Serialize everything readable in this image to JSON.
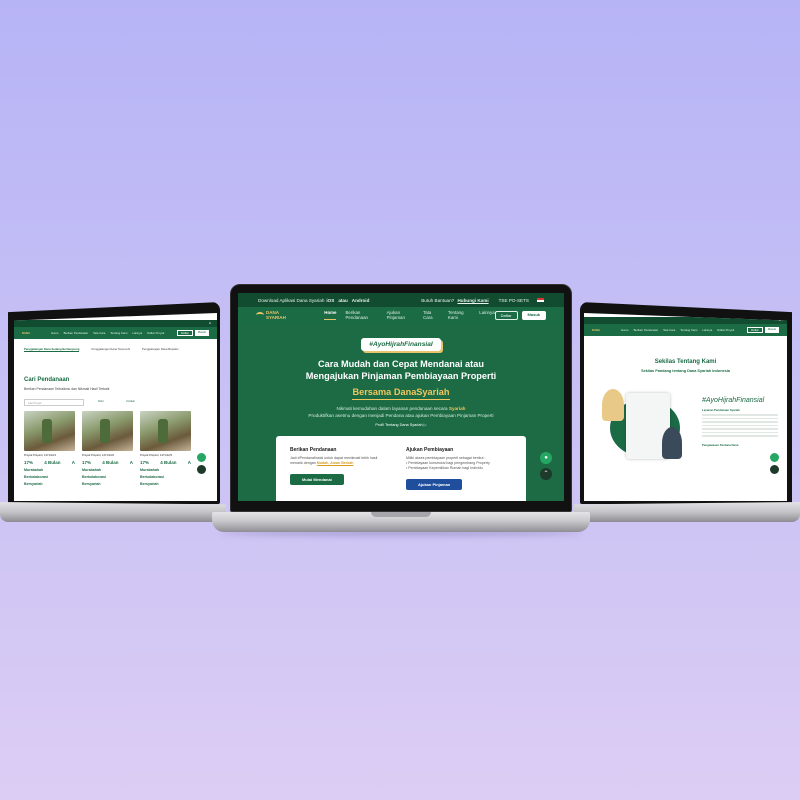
{
  "center": {
    "topbar": {
      "download_prefix": "Download Aplikasi Dana Syariah",
      "ios": "iOS",
      "and_word": "atau",
      "android": "Android",
      "help_prefix": "Butuh Bantuan?",
      "help_link": "Hubungi Kami",
      "phone": "TSE PO-SETS"
    },
    "nav": {
      "logo": "DANA SYARIAH",
      "links": [
        "Home",
        "Berikan Pendanaan",
        "Ajukan Pinjaman",
        "Tata Cara",
        "Tentang Kami",
        "Lainnya"
      ],
      "btn_daftar": "Daftar",
      "btn_masuk": "Masuk"
    },
    "hero": {
      "tag": "#AyoHijrahFinansial",
      "line1": "Cara Mudah dan Cepat Mendanai atau",
      "line2": "Mengajukan Pinjaman Pembiayaan Properti",
      "line3": "Bersama DanaSyariah",
      "desc1_pre": "Nikmati kemudahan dalam layanan pendanaan secara",
      "desc1_hl": "Syariah",
      "desc2": "Produktifkan asetmu dengan menjadi Pendana atau ajukan Pembiayaan Pinjaman Properti",
      "play": "Profil Tentang Dana Syariah"
    },
    "card": {
      "left_title": "Berikan Pendanaan",
      "left_p1": "Jadi #Pendanafinsial untuk dapat menikmati lebih hasil",
      "left_p2": "menarik dengan",
      "left_hl": "Mudah, Aman Berkah",
      "left_btn": "Mulai Mendanai",
      "right_title": "Ajukan Pembiayaan",
      "right_p1": "Miliki akses pembiayaan properti sebagai berikut :",
      "right_b1": "Pembiayaan konstruksi bagi pengembang Property",
      "right_b2": "Pembiayaan Kepemilikan Rumah bagi Individu",
      "right_btn": "Ajukan Pinjaman"
    },
    "colors": {
      "green": "#1b6b45",
      "blue": "#1f4f9c",
      "gold": "#f0c75e"
    }
  },
  "left": {
    "top_right": "Id",
    "nav": {
      "logo": "DANA",
      "links": [
        "Home",
        "Berikan Pendanaan",
        "Tata Cara",
        "Tentang Kami",
        "Lainnya"
      ],
      "proyek": "Daftar Proyek",
      "b1": "Daftar",
      "b2": "Masuk"
    },
    "tabs": [
      "Penggalangan Dana Sedang Berlangsung",
      "Penggalangan Dana Terpenuhi",
      "Penggalangan Dana Berjalan"
    ],
    "title": "Cari Pendanaan",
    "subtitle": "Berikan Pendanaan Terbaikmu dan Nikmati Hasil Terbaik",
    "search": "Cari Proyek",
    "filter": "Filter",
    "sort": "Urutkan",
    "cards": [
      {
        "name": "Proyek Properti, 1471/12/1",
        "pct": "17%",
        "dur": "4 Bulan",
        "grade": "A",
        "akad": "Murabahah",
        "status": "Berkolaborasi",
        "dana": "Bersyariah"
      },
      {
        "name": "Proyek Properti, 1471/12/2",
        "pct": "17%",
        "dur": "4 Bulan",
        "grade": "A",
        "akad": "Murabahah",
        "status": "Berkolaborasi",
        "dana": "Bersyariah"
      },
      {
        "name": "Proyek Properti, 1471/12/3",
        "pct": "17%",
        "dur": "4 Bulan",
        "grade": "A",
        "akad": "Murabahah",
        "status": "Berkolaborasi",
        "dana": "Bersyariah"
      }
    ]
  },
  "right": {
    "top_right": "Id",
    "nav": {
      "logo": "DANA",
      "links": [
        "Home",
        "Berikan Pendanaan",
        "Tata Cara",
        "Tentang Kami",
        "Lainnya"
      ],
      "proyek": "Daftar Proyek",
      "b1": "Daftar",
      "b2": "Masuk"
    },
    "title": "Sekilas Tentang Kami",
    "subtitle": "Sekilas Pandang tentang Dana Syariah Indonesia",
    "hashtag": "#AyoHijrahFinansial",
    "acc1": "Layanan Pendanaan Syariah",
    "acc2": "Pengawasan Perdana Dana"
  }
}
